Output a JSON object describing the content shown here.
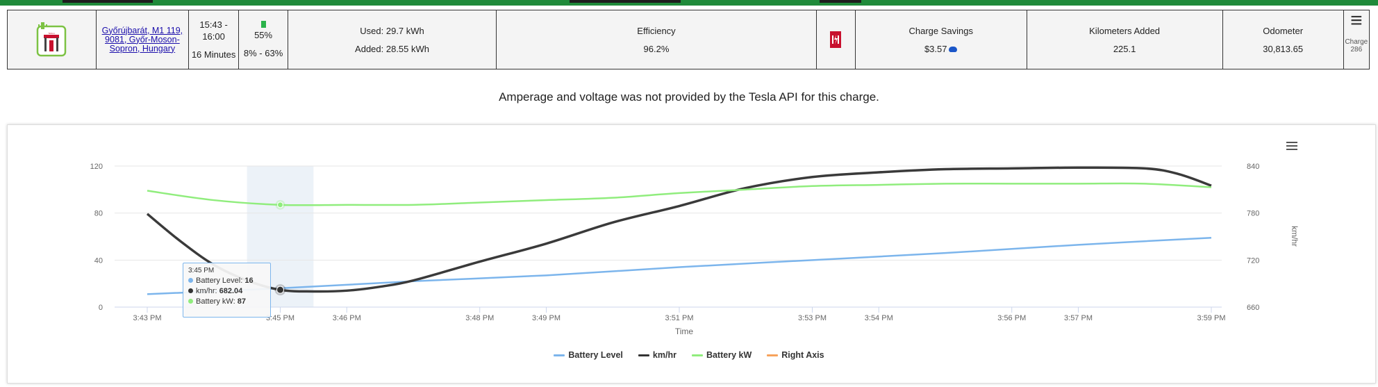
{
  "summary": {
    "location": "Győrújbarát, M1 119, 9081, Győr-Moson-Sopron, Hungary",
    "time_range": "15:43 - 16:00",
    "duration": "16 Minutes",
    "battery_end": "55%",
    "battery_range": "8% - 63%",
    "energy_used": "Used: 29.7 kWh",
    "energy_added": "Added: 28.55 kWh",
    "efficiency_label": "Efficiency",
    "efficiency_value": "96.2%",
    "savings_label": "Charge Savings",
    "savings_value": "$3.57",
    "km_added_label": "Kilometers Added",
    "km_added_value": "225.1",
    "odometer_label": "Odometer",
    "odometer_value": "30,813.65",
    "charge_label": "Charge",
    "charge_number": "286"
  },
  "notice": "Amperage and voltage was not provided by the Tesla API for this charge.",
  "tooltip": {
    "time": "3:45 PM",
    "rows": [
      {
        "label": "Battery Level: ",
        "value": "16",
        "color": "#7cb5ec"
      },
      {
        "label": "km/hr: ",
        "value": "682.04",
        "color": "#333333"
      },
      {
        "label": "Battery kW: ",
        "value": "87",
        "color": "#90ed7d"
      }
    ]
  },
  "chart_data": {
    "type": "line",
    "xlabel": "Time",
    "ylabel_right": "km/hr",
    "x_ticks": [
      "3:43 PM",
      "3:45 PM",
      "3:46 PM",
      "3:48 PM",
      "3:49 PM",
      "3:51 PM",
      "3:53 PM",
      "3:54 PM",
      "3:56 PM",
      "3:57 PM",
      "3:59 PM"
    ],
    "y_left_ticks": [
      "0",
      "40",
      "80",
      "120"
    ],
    "y_right_ticks": [
      "660",
      "720",
      "780",
      "840"
    ],
    "ylim_left": [
      0,
      120
    ],
    "ylim_right": [
      660,
      840
    ],
    "xlim_minutes": [
      0,
      16
    ],
    "highlight_band_minutes": [
      1.5,
      2.5
    ],
    "series": [
      {
        "name": "Battery Level",
        "axis": "left",
        "color": "#7cb5ec",
        "x": [
          0,
          2,
          4,
          6,
          8,
          10,
          12,
          14,
          16
        ],
        "y": [
          11,
          16,
          22,
          27,
          34,
          40,
          46,
          53,
          59
        ]
      },
      {
        "name": "km/hr",
        "axis": "right",
        "color": "#3a3a3a",
        "x": [
          0,
          0.5,
          1,
          1.5,
          2,
          2.5,
          3,
          3.5,
          4,
          5,
          6,
          7,
          8,
          9,
          10,
          11,
          12,
          13,
          14,
          15,
          15.5,
          16
        ],
        "y": [
          779,
          744,
          714,
          694,
          682,
          680,
          681,
          686,
          694,
          718,
          741,
          768,
          789,
          812,
          826,
          832,
          836,
          837,
          838,
          837,
          830,
          815
        ]
      },
      {
        "name": "Battery kW",
        "axis": "left",
        "color": "#90ed7d",
        "x": [
          0,
          1,
          2,
          3,
          4,
          5,
          6,
          7,
          8,
          9,
          10,
          11,
          12,
          13,
          14,
          15,
          16
        ],
        "y": [
          99,
          91,
          87,
          87,
          87,
          89,
          91,
          93,
          97,
          100,
          103,
          104,
          105,
          105,
          105,
          105,
          102
        ]
      },
      {
        "name": "Right Axis",
        "axis": "right",
        "color": "#f7a35c",
        "x": [],
        "y": []
      }
    ],
    "highlight_point": {
      "x": 2,
      "battery_level": 16,
      "km_hr": 682.04,
      "battery_kw": 87
    }
  }
}
